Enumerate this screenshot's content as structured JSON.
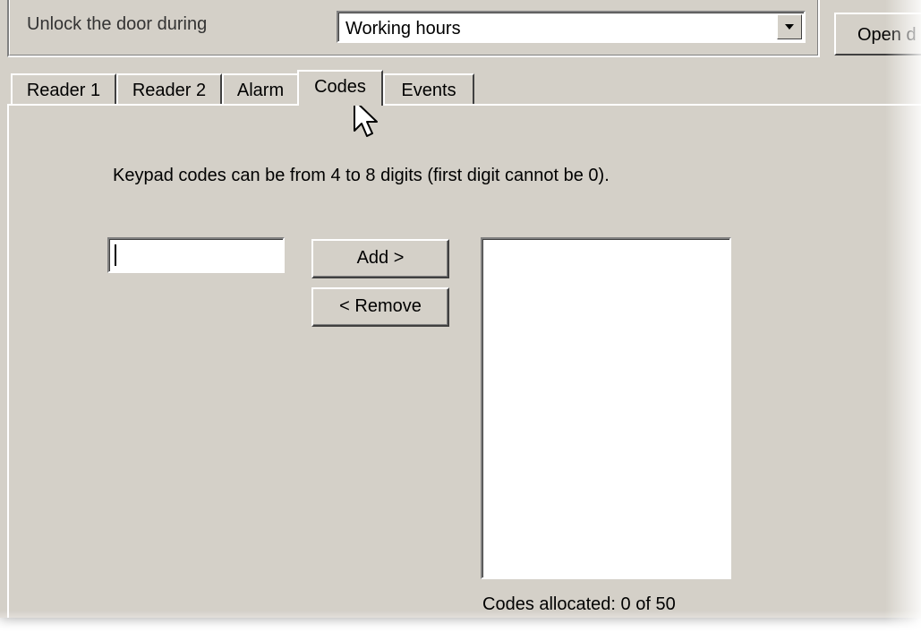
{
  "header": {
    "unlock_label": "Unlock the door during",
    "schedule_value": "Working hours",
    "open_button_label": "Open d"
  },
  "tabs": [
    {
      "label": "Reader 1",
      "active": false
    },
    {
      "label": "Reader 2",
      "active": false
    },
    {
      "label": "Alarm",
      "active": false
    },
    {
      "label": "Codes",
      "active": true
    },
    {
      "label": "Events",
      "active": false
    }
  ],
  "codes": {
    "hint": "Keypad codes can be from 4 to 8 digits (first digit cannot be 0).",
    "input_value": "",
    "add_label": "Add >",
    "remove_label": "< Remove",
    "allocated_text": "Codes allocated: 0 of 50",
    "codes_list": []
  },
  "colors": {
    "dialog_bg": "#d4d0c8",
    "field_bg": "#ffffff"
  },
  "icons": {
    "dropdown": "chevron-down-icon",
    "pointer": "mouse-cursor-icon"
  }
}
